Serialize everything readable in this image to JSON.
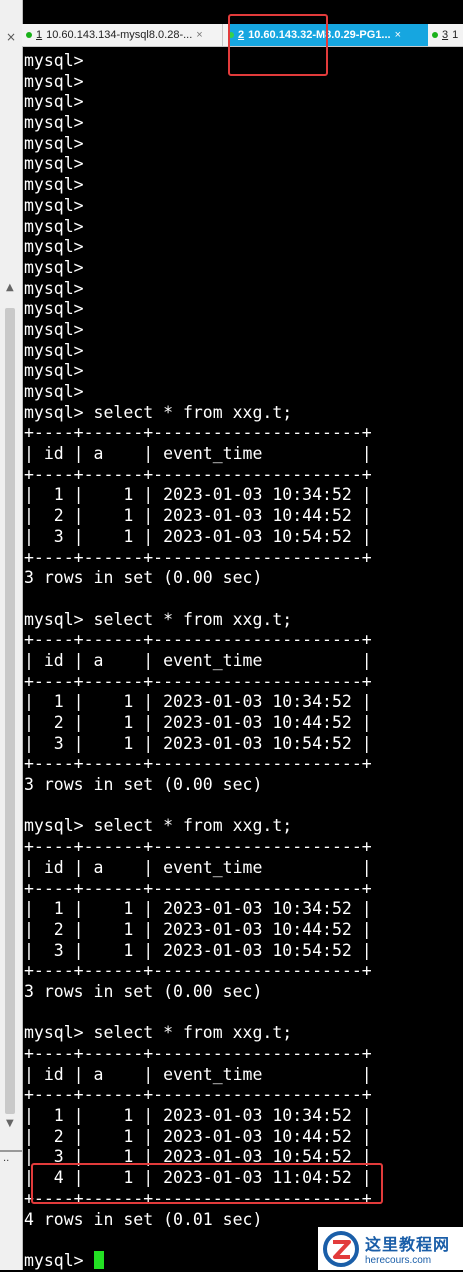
{
  "tabs": [
    {
      "number": "1",
      "label": "10.60.143.134-mysql8.0.28-...",
      "close": "×",
      "connected": true
    },
    {
      "number": "2",
      "label": "10.60.143.32-M8.0.29-PG1...",
      "close": "×",
      "connected": true,
      "active": true
    },
    {
      "number": "3",
      "label": "1",
      "close": "",
      "connected": true
    }
  ],
  "colors": {
    "highlight_box": "#e23b3b",
    "active_tab": "#16a6e0",
    "cursor": "#23e023",
    "terminal_bg": "#000000"
  },
  "terminal": {
    "lines": [
      "mysql>",
      "mysql>",
      "mysql>",
      "mysql>",
      "mysql>",
      "mysql>",
      "mysql>",
      "mysql>",
      "mysql>",
      "mysql>",
      "mysql>",
      "mysql>",
      "mysql>",
      "mysql>",
      "mysql>",
      "mysql>",
      "mysql>",
      "mysql> select * from xxg.t;",
      "+----+------+---------------------+",
      "| id | a    | event_time          |",
      "+----+------+---------------------+",
      "|  1 |    1 | 2023-01-03 10:34:52 |",
      "|  2 |    1 | 2023-01-03 10:44:52 |",
      "|  3 |    1 | 2023-01-03 10:54:52 |",
      "+----+------+---------------------+",
      "3 rows in set (0.00 sec)",
      "",
      "mysql> select * from xxg.t;",
      "+----+------+---------------------+",
      "| id | a    | event_time          |",
      "+----+------+---------------------+",
      "|  1 |    1 | 2023-01-03 10:34:52 |",
      "|  2 |    1 | 2023-01-03 10:44:52 |",
      "|  3 |    1 | 2023-01-03 10:54:52 |",
      "+----+------+---------------------+",
      "3 rows in set (0.00 sec)",
      "",
      "mysql> select * from xxg.t;",
      "+----+------+---------------------+",
      "| id | a    | event_time          |",
      "+----+------+---------------------+",
      "|  1 |    1 | 2023-01-03 10:34:52 |",
      "|  2 |    1 | 2023-01-03 10:44:52 |",
      "|  3 |    1 | 2023-01-03 10:54:52 |",
      "+----+------+---------------------+",
      "3 rows in set (0.00 sec)",
      "",
      "mysql> select * from xxg.t;",
      "+----+------+---------------------+",
      "| id | a    | event_time          |",
      "+----+------+---------------------+",
      "|  1 |    1 | 2023-01-03 10:34:52 |",
      "|  2 |    1 | 2023-01-03 10:44:52 |",
      "|  3 |    1 | 2023-01-03 10:54:52 |",
      "|  4 |    1 | 2023-01-03 11:04:52 |",
      "+----+------+---------------------+",
      "4 rows in set (0.01 sec)",
      ""
    ],
    "prompt": "mysql> "
  },
  "watermark": {
    "title": "这里教程网",
    "url": "herecours.com"
  }
}
